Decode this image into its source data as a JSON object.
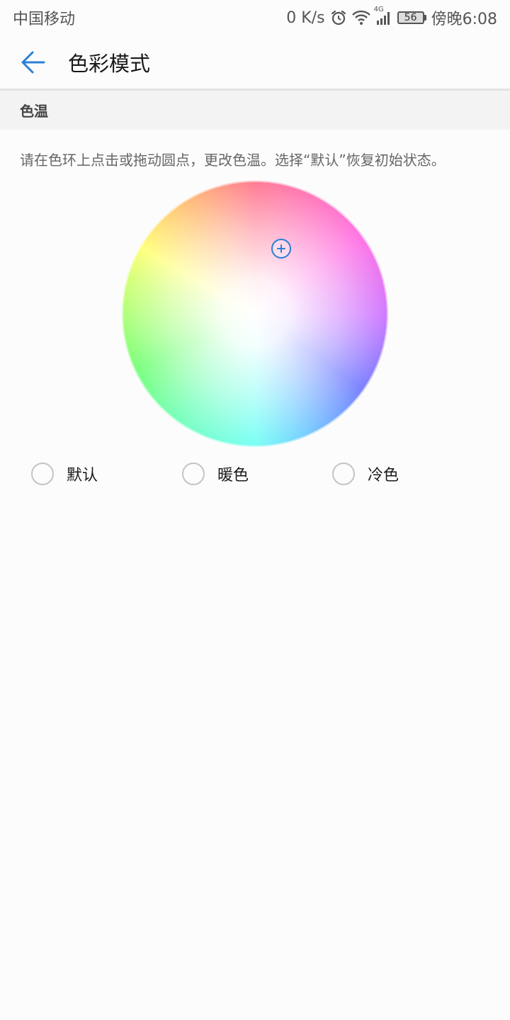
{
  "status_bar": {
    "carrier": "中国移动",
    "network_speed": "0 K/s",
    "network_type": "4G",
    "battery_level": "56",
    "time": "傍晚6:08",
    "icons": [
      "alarm-icon",
      "wifi-icon",
      "signal-icon",
      "battery-icon"
    ]
  },
  "app_bar": {
    "back_icon": "arrow-left-icon",
    "title": "色彩模式"
  },
  "section": {
    "header": "色温"
  },
  "description": "请在色环上点击或拖动圆点，更改色温。选择“默认”恢复初始状态。",
  "color_wheel": {
    "handle_icon": "plus-icon"
  },
  "options": [
    {
      "label": "默认",
      "selected": false
    },
    {
      "label": "暖色",
      "selected": false
    },
    {
      "label": "冷色",
      "selected": false
    }
  ],
  "colors": {
    "accent": "#2a7fd4",
    "background": "#fcfcfc",
    "section_bg": "#f3f3f3",
    "divider": "#e2e2e2",
    "radio_border": "#c4c4c4"
  }
}
